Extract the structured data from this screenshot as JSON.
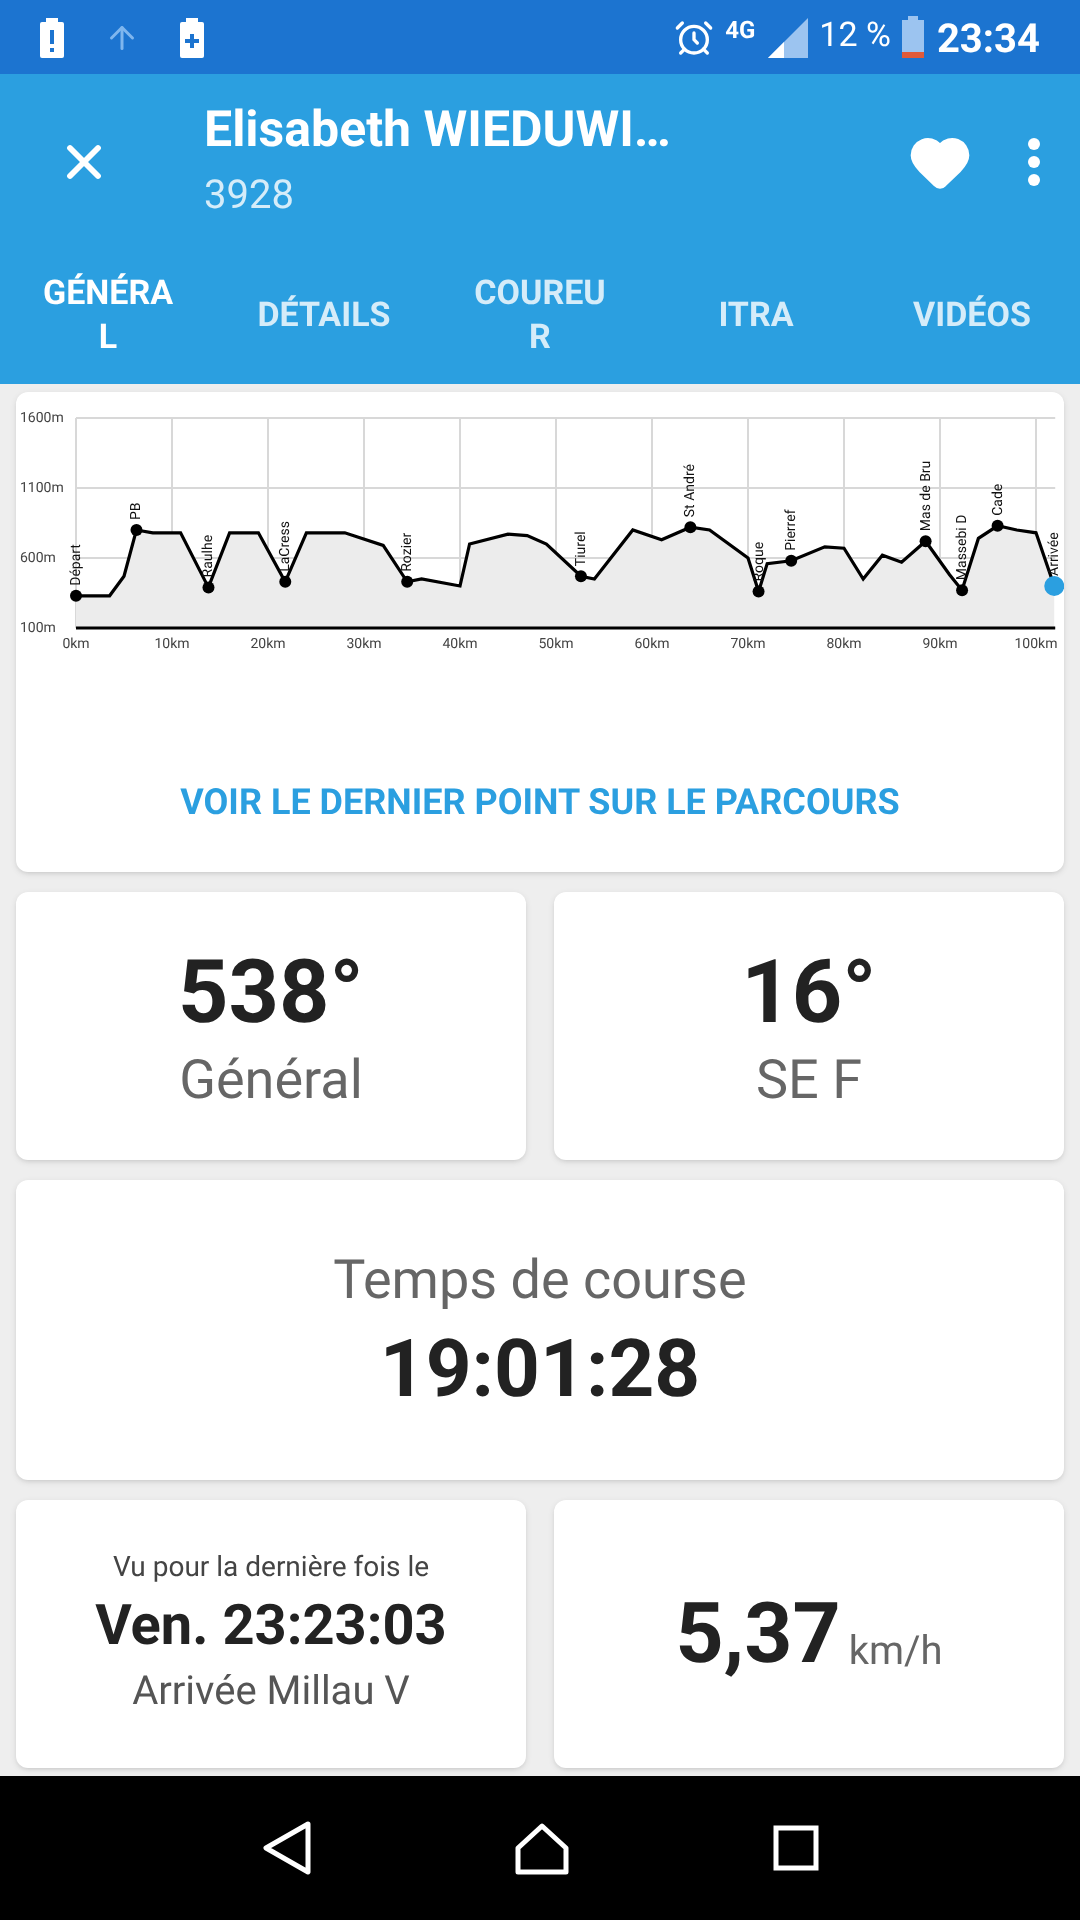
{
  "status_bar": {
    "network": "4G",
    "battery_percent": "12 %",
    "time": "23:34"
  },
  "header": {
    "title": "Elisabeth WIEDUWI…",
    "subtitle": "3928",
    "favorite": true
  },
  "tabs": [
    {
      "label": "GÉNÉRAL",
      "selected": true
    },
    {
      "label": "DÉTAILS",
      "selected": false
    },
    {
      "label": "COUREUR",
      "selected": false
    },
    {
      "label": "ITRA",
      "selected": false
    },
    {
      "label": "VIDÉOS",
      "selected": false
    }
  ],
  "profile": {
    "chart_data": {
      "type": "area",
      "x": [
        0,
        3.5,
        5,
        6.3,
        8,
        10.9,
        13.8,
        16,
        19,
        21.8,
        24,
        28,
        32,
        34.5,
        36,
        40,
        41,
        45,
        47,
        49,
        52.6,
        54,
        58,
        61,
        64,
        66,
        70,
        71.1,
        72,
        74.5,
        78,
        80,
        82,
        84,
        86,
        88.5,
        91,
        92.3,
        94,
        96,
        98,
        100,
        101.9
      ],
      "grid": true,
      "series": [
        {
          "color": "#000000",
          "values": [
            330,
            330,
            470,
            800,
            780,
            780,
            390,
            780,
            780,
            430,
            780,
            780,
            690,
            430,
            450,
            400,
            700,
            770,
            760,
            700,
            470,
            450,
            800,
            730,
            820,
            800,
            600,
            360,
            560,
            580,
            680,
            670,
            450,
            620,
            570,
            720,
            480,
            370,
            740,
            830,
            800,
            780,
            400
          ]
        }
      ],
      "xlim": [
        0,
        102
      ],
      "ylim": [
        100,
        1600
      ],
      "xticks": [
        {
          "value": 0,
          "label": "0km"
        },
        {
          "value": 10,
          "label": "10km"
        },
        {
          "value": 20,
          "label": "20km"
        },
        {
          "value": 30,
          "label": "30km"
        },
        {
          "value": 40,
          "label": "40km"
        },
        {
          "value": 50,
          "label": "50km"
        },
        {
          "value": 60,
          "label": "60km"
        },
        {
          "value": 70,
          "label": "70km"
        },
        {
          "value": 80,
          "label": "80km"
        },
        {
          "value": 90,
          "label": "90km"
        },
        {
          "value": 100,
          "label": "100km"
        }
      ],
      "yticks": [
        {
          "value": 100,
          "label": "100m"
        },
        {
          "value": 600,
          "label": "600m"
        },
        {
          "value": 1100,
          "label": "1100m"
        },
        {
          "value": 1600,
          "label": "1600m"
        }
      ],
      "annotations": [
        {
          "x": 0,
          "y": 330,
          "text": "Départ"
        },
        {
          "x": 6.3,
          "y": 800,
          "text": "PB"
        },
        {
          "x": 13.8,
          "y": 390,
          "text": "Raulhe"
        },
        {
          "x": 21.8,
          "y": 430,
          "text": "LaCress"
        },
        {
          "x": 34.5,
          "y": 430,
          "text": "Rozier"
        },
        {
          "x": 52.6,
          "y": 470,
          "text": "Tiurel"
        },
        {
          "x": 64,
          "y": 820,
          "text": "St André"
        },
        {
          "x": 71.1,
          "y": 360,
          "text": "Roque"
        },
        {
          "x": 74.5,
          "y": 580,
          "text": "Pierref"
        },
        {
          "x": 88.5,
          "y": 720,
          "text": "Mas de Bru"
        },
        {
          "x": 92.3,
          "y": 370,
          "text": "Massebi D"
        },
        {
          "x": 96,
          "y": 830,
          "text": "Cade"
        },
        {
          "x": 101.9,
          "y": 400,
          "text": "Arrivée"
        }
      ]
    },
    "link": "VOIR LE DERNIER POINT SUR LE PARCOURS"
  },
  "rank_general": {
    "value": "538°",
    "label": "Général"
  },
  "rank_category": {
    "value": "16°",
    "label": "SE F"
  },
  "race_time": {
    "label": "Temps de course",
    "value": "19:01:28"
  },
  "last_seen": {
    "label": "Vu pour la dernière fois le",
    "value": "Ven. 23:23:03",
    "place": "Arrivée Millau V"
  },
  "speed": {
    "value": "5,37",
    "unit": "km/h"
  }
}
